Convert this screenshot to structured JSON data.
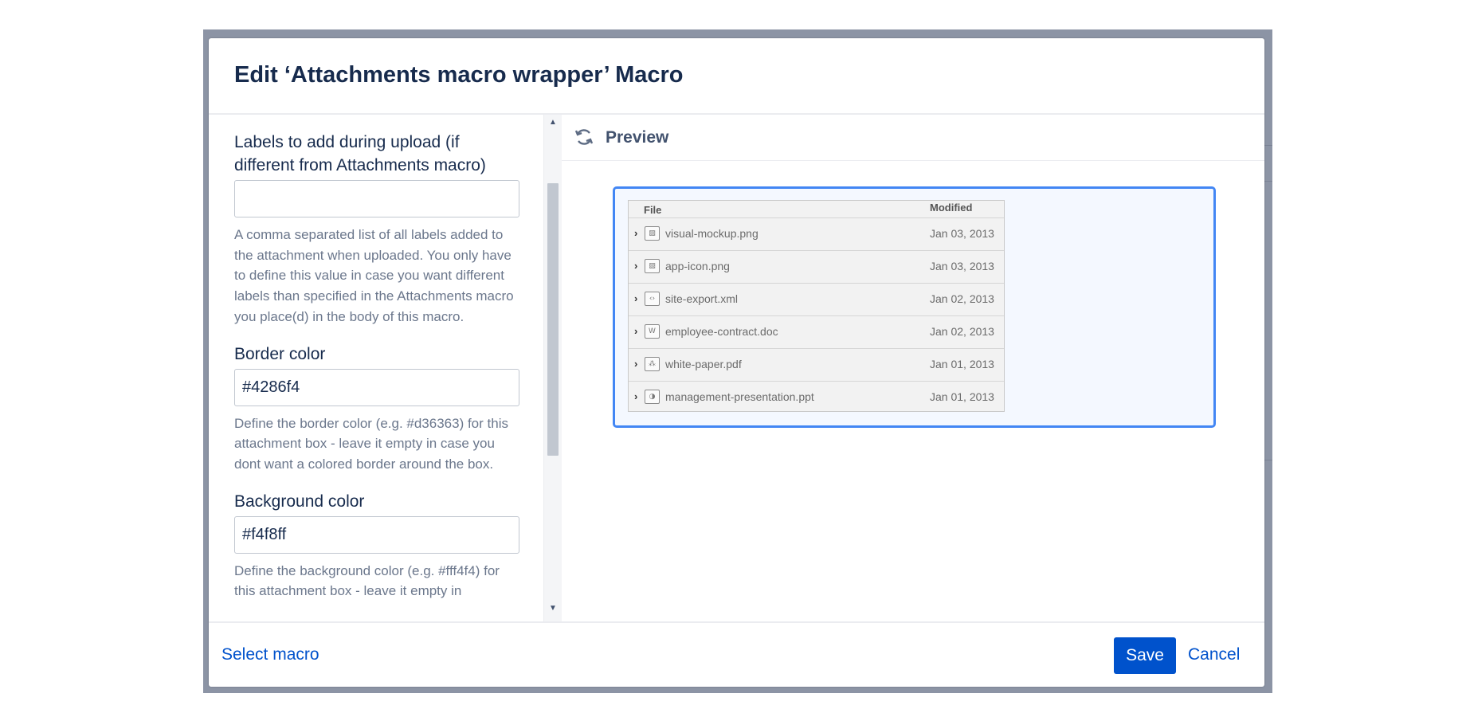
{
  "dialog": {
    "title": "Edit ‘Attachments macro wrapper’ Macro"
  },
  "params": [
    {
      "label": "Labels to add during upload (if different from Attachments macro)",
      "value": "",
      "description": "A comma separated list of all labels added to the attachment when uploaded. You only have to define this value in case you want different labels than specified in the Attachments macro you place(d) in the body of this macro."
    },
    {
      "label": "Border color",
      "value": "#4286f4",
      "description": "Define the border color (e.g. #d36363) for this attachment box - leave it empty in case you dont want a colored border around the box."
    },
    {
      "label": "Background color",
      "value": "#f4f8ff",
      "description": "Define the background color (e.g. #fff4f4) for this attachment box - leave it empty in"
    }
  ],
  "preview": {
    "title": "Preview",
    "box_border_color": "#4286f4",
    "box_background_color": "#f4f8ff",
    "table": {
      "col_file": "File",
      "col_modified": "Modified",
      "rows": [
        {
          "icon": "image-file-icon",
          "glyph": "▨",
          "name": "visual-mockup.png",
          "modified": "Jan 03, 2013"
        },
        {
          "icon": "image-file-icon",
          "glyph": "▨",
          "name": "app-icon.png",
          "modified": "Jan 03, 2013"
        },
        {
          "icon": "xml-file-icon",
          "glyph": "‹›",
          "name": "site-export.xml",
          "modified": "Jan 02, 2013"
        },
        {
          "icon": "word-file-icon",
          "glyph": "W",
          "name": "employee-contract.doc",
          "modified": "Jan 02, 2013"
        },
        {
          "icon": "pdf-file-icon",
          "glyph": "⁂",
          "name": "white-paper.pdf",
          "modified": "Jan 01, 2013"
        },
        {
          "icon": "presentation-file-icon",
          "glyph": "◑",
          "name": "management-presentation.ppt",
          "modified": "Jan 01, 2013"
        }
      ]
    }
  },
  "footer": {
    "select_macro": "Select macro",
    "save": "Save",
    "cancel": "Cancel"
  },
  "colors": {
    "primary": "#0052cc",
    "title": "#172b4d",
    "overlay": "#8c94a5"
  }
}
